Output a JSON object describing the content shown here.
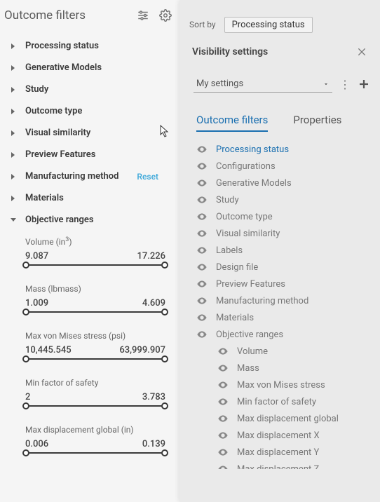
{
  "leftPanel": {
    "title": "Outcome filters",
    "items": [
      {
        "label": "Processing status"
      },
      {
        "label": "Generative Models"
      },
      {
        "label": "Study"
      },
      {
        "label": "Outcome type"
      },
      {
        "label": "Visual similarity"
      },
      {
        "label": "Preview Features"
      },
      {
        "label": "Manufacturing method",
        "reset": "Reset"
      },
      {
        "label": "Materials"
      },
      {
        "label": "Objective ranges",
        "expanded": true
      }
    ],
    "ranges": [
      {
        "label": "Volume (in",
        "sup": "3",
        "suffix": ")",
        "min": "9.087",
        "max": "17.226"
      },
      {
        "label": "Mass (lbmass)",
        "min": "1.009",
        "max": "4.609"
      },
      {
        "label": "Max von Mises stress (psi)",
        "min": "10,445.545",
        "max": "63,999.907"
      },
      {
        "label": "Min factor of safety",
        "min": "2",
        "max": "3.783"
      },
      {
        "label": "Max displacement global (in)",
        "min": "0.006",
        "max": "0.139"
      }
    ]
  },
  "rightPanel": {
    "sortBy": {
      "label": "Sort by",
      "value": "Processing status"
    },
    "vsTitle": "Visibility settings",
    "settingsSelect": "My settings",
    "tabs": [
      {
        "label": "Outcome filters",
        "active": true
      },
      {
        "label": "Properties"
      }
    ],
    "visItems": [
      {
        "label": "Processing status",
        "selected": true
      },
      {
        "label": "Configurations"
      },
      {
        "label": "Generative Models"
      },
      {
        "label": "Study"
      },
      {
        "label": "Outcome type"
      },
      {
        "label": "Visual similarity"
      },
      {
        "label": "Labels"
      },
      {
        "label": "Design file"
      },
      {
        "label": "Preview Features"
      },
      {
        "label": "Manufacturing method"
      },
      {
        "label": "Materials"
      },
      {
        "label": "Objective ranges"
      },
      {
        "label": "Volume",
        "indent": true
      },
      {
        "label": "Mass",
        "indent": true
      },
      {
        "label": "Max von Mises stress",
        "indent": true
      },
      {
        "label": "Min factor of safety",
        "indent": true
      },
      {
        "label": "Max displacement global",
        "indent": true
      },
      {
        "label": "Max displacement X",
        "indent": true
      },
      {
        "label": "Max displacement Y",
        "indent": true
      },
      {
        "label": "Max displacement Z",
        "indent": true
      }
    ]
  }
}
